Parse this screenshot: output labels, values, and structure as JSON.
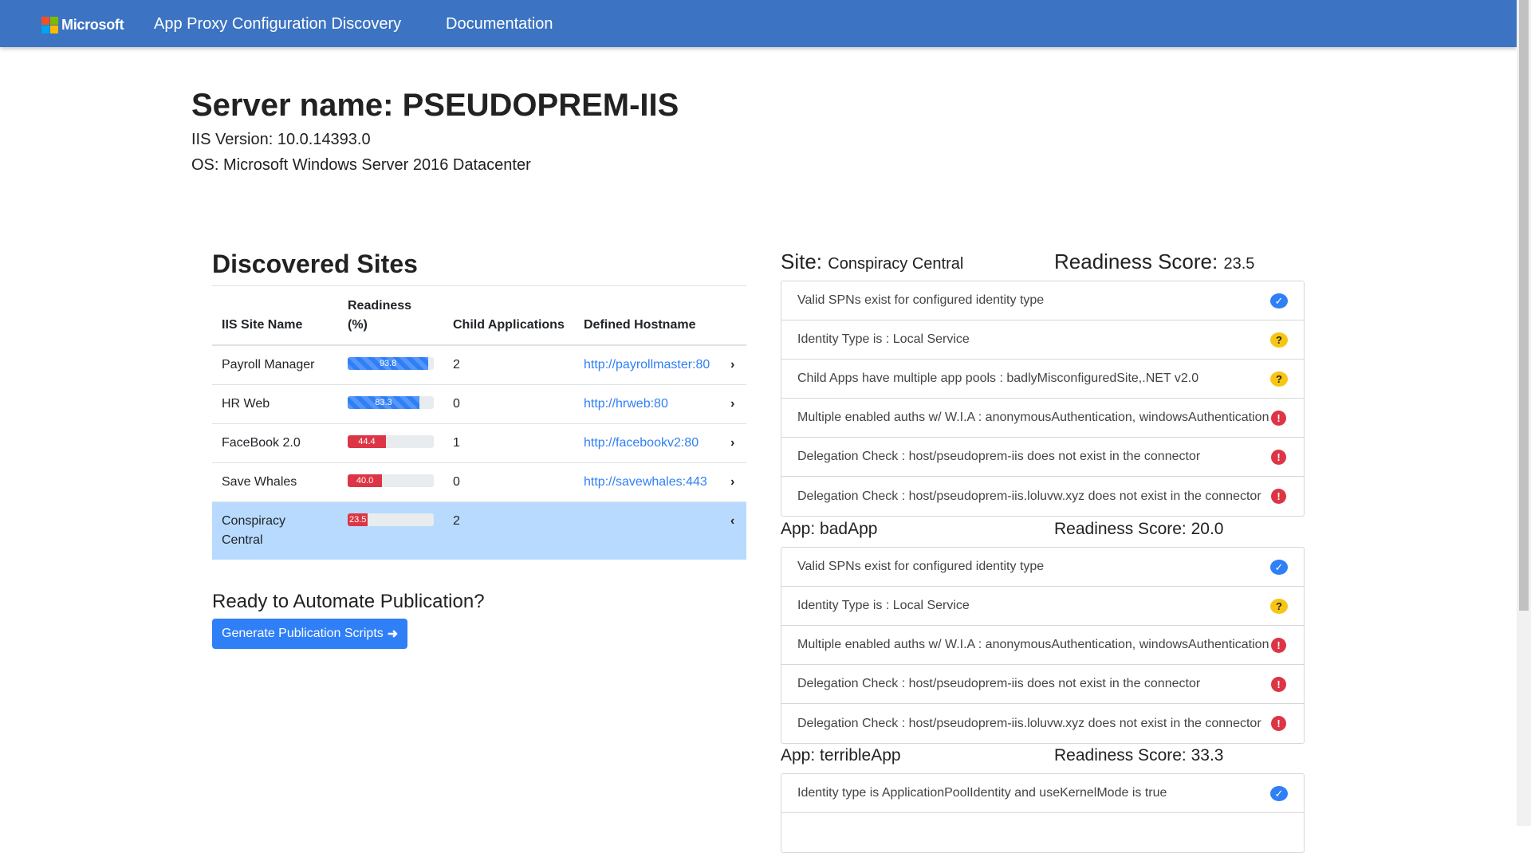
{
  "nav": {
    "brand": "Microsoft",
    "app_title": "App Proxy Configuration Discovery",
    "docs": "Documentation",
    "colors": {
      "navbar": "#3c73c2",
      "logo": [
        "#f25022",
        "#7fba00",
        "#00a4ef",
        "#ffb900"
      ]
    }
  },
  "server": {
    "title": "Server name: PSEUDOPREM-IIS",
    "iis_version": "IIS Version: 10.0.14393.0",
    "os": "OS: Microsoft Windows Server 2016 Datacenter"
  },
  "sites": {
    "heading": "Discovered Sites",
    "columns": [
      "IIS Site Name",
      "Readiness (%)",
      "Child Applications",
      "Defined Hostname"
    ],
    "rows": [
      {
        "name": "Payroll Manager",
        "readiness": 93.8,
        "readiness_label": "93.8",
        "children": "2",
        "hostname": "http://payrollmaster:80",
        "status": "good"
      },
      {
        "name": "HR Web",
        "readiness": 83.3,
        "readiness_label": "83.3",
        "children": "0",
        "hostname": "http://hrweb:80",
        "status": "good"
      },
      {
        "name": "FaceBook 2.0",
        "readiness": 44.4,
        "readiness_label": "44.4",
        "children": "1",
        "hostname": "http://facebookv2:80",
        "status": "bad"
      },
      {
        "name": "Save Whales",
        "readiness": 40.0,
        "readiness_label": "40.0",
        "children": "0",
        "hostname": "http://savewhales:443",
        "status": "bad"
      },
      {
        "name": "Conspiracy Central",
        "readiness": 23.5,
        "readiness_label": "23.5",
        "children": "2",
        "hostname": "",
        "status": "bad",
        "selected": true
      }
    ]
  },
  "automate": {
    "heading": "Ready to Automate Publication?",
    "button": "Generate Publication Scripts"
  },
  "detail": {
    "site_label": "Site:",
    "site_name": "Conspiracy Central",
    "score_label": "Readiness Score:",
    "score": "23.5",
    "site_checks": [
      {
        "text": "Valid SPNs exist for configured identity type",
        "icon": "check-icon"
      },
      {
        "text": "Identity Type is : Local Service",
        "icon": "question-icon"
      },
      {
        "text": "Child Apps have multiple app pools : badlyMisconfiguredSite,.NET v2.0",
        "icon": "question-icon"
      },
      {
        "text": "Multiple enabled auths w/ W.I.A : anonymousAuthentication, windowsAuthentication",
        "icon": "error-icon"
      },
      {
        "text": "Delegation Check : host/pseudoprem-iis does not exist in the connector",
        "icon": "error-icon"
      },
      {
        "text": "Delegation Check : host/pseudoprem-iis.loluvw.xyz does not exist in the connector",
        "icon": "error-icon"
      }
    ],
    "apps": [
      {
        "title": "App: badApp",
        "score": "Readiness Score: 20.0",
        "checks": [
          {
            "text": "Valid SPNs exist for configured identity type",
            "icon": "check-icon"
          },
          {
            "text": "Identity Type is : Local Service",
            "icon": "question-icon"
          },
          {
            "text": "Multiple enabled auths w/ W.I.A : anonymousAuthentication, windowsAuthentication",
            "icon": "error-icon"
          },
          {
            "text": "Delegation Check : host/pseudoprem-iis does not exist in the connector",
            "icon": "error-icon"
          },
          {
            "text": "Delegation Check : host/pseudoprem-iis.loluvw.xyz does not exist in the connector",
            "icon": "error-icon"
          }
        ]
      },
      {
        "title": "App: terribleApp",
        "score": "Readiness Score: 33.3",
        "checks": [
          {
            "text": "Identity type is ApplicationPoolIdentity and useKernelMode is true",
            "icon": "check-icon"
          },
          {
            "text": "",
            "icon": ""
          }
        ]
      }
    ]
  }
}
